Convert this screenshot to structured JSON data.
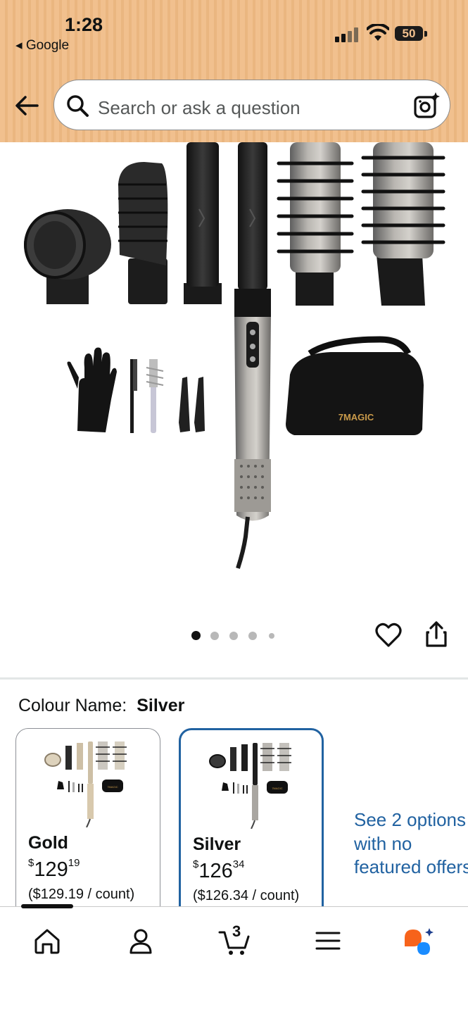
{
  "status_bar": {
    "time": "1:28",
    "back_app": "◂ Google",
    "battery": "50"
  },
  "search": {
    "placeholder": "Search or ask a question"
  },
  "product": {
    "brand_on_case": "7MAGIC",
    "image_count": 5,
    "active_image_index": 0
  },
  "variation": {
    "label": "Colour Name:",
    "selected": "Silver",
    "options": [
      {
        "name": "Gold",
        "currency": "$",
        "price_whole": "129",
        "price_fraction": "19",
        "unit_price": "($129.19 / count)"
      },
      {
        "name": "Silver",
        "currency": "$",
        "price_whole": "126",
        "price_fraction": "34",
        "unit_price": "($126.34 / count)"
      }
    ],
    "see_more": "See 2 options with no featured offers"
  },
  "bottom_nav": {
    "items": [
      "home-icon",
      "account-icon",
      "cart-icon",
      "menu-icon",
      "rufus-icon"
    ],
    "cart_count": "3"
  },
  "colors": {
    "header_bg": "#f1c08e",
    "link": "#2162a1",
    "rufus_orange": "#f7631b",
    "rufus_blue": "#1a8cff"
  }
}
